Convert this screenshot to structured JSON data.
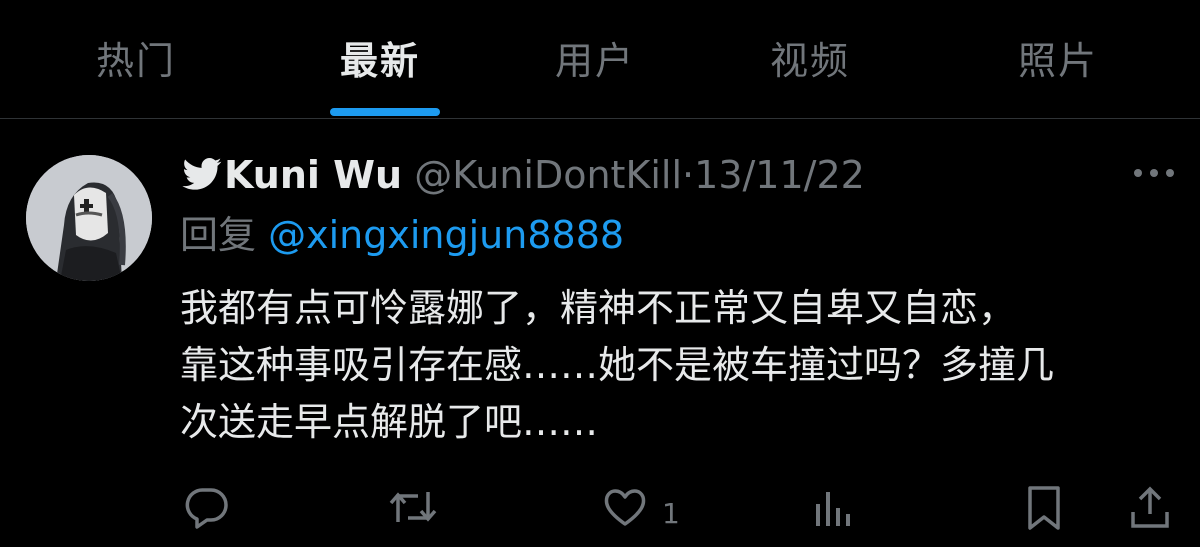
{
  "tabs": [
    {
      "label": "热门",
      "active": false
    },
    {
      "label": "最新",
      "active": true
    },
    {
      "label": "用户",
      "active": false
    },
    {
      "label": "视频",
      "active": false
    },
    {
      "label": "照片",
      "active": false
    }
  ],
  "tweet": {
    "display_name": "Kuni Wu",
    "handle": "@KuniDontKill",
    "separator": "·",
    "date": "13/11/22",
    "reply_prefix": "回复",
    "reply_to": "@xingxingjun8888",
    "body_lines": [
      "我都有点可怜露娜了，精神不正常又自卑又自恋，",
      "靠这种事吸引存在感……她不是被车撞过吗？多撞几",
      "次送走早点解脱了吧……"
    ],
    "like_count": "1"
  },
  "icons": {
    "bird": "twitter-bird-icon",
    "more": "more-dots-icon",
    "reply": "reply-bubble-icon",
    "retweet": "retweet-icon",
    "like": "heart-icon",
    "views": "analytics-bars-icon",
    "bookmark": "bookmark-icon",
    "share": "share-icon"
  },
  "colors": {
    "background": "#000000",
    "text": "#e7e9ea",
    "muted": "#71767b",
    "accent": "#1d9bf0",
    "divider": "#2f3336"
  }
}
